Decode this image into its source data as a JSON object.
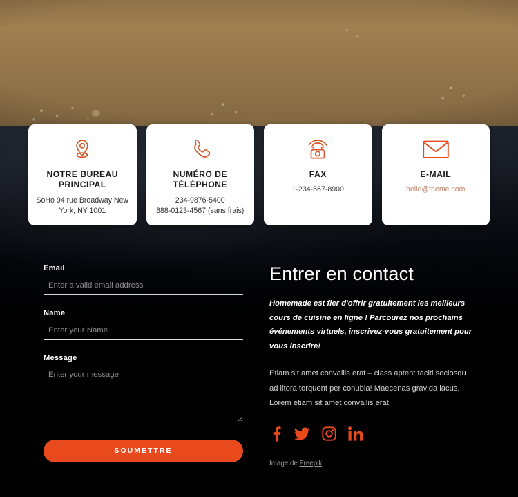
{
  "hero": {
    "alt": "fresh vegetables on dark slate background"
  },
  "cards": [
    {
      "icon": "location-pin-icon",
      "title": "NOTRE BUREAU PRINCIPAL",
      "text": "SoHo 94 rue Broadway New York, NY 1001",
      "is_link": false
    },
    {
      "icon": "phone-handset-icon",
      "title": "NUMÉRO DE TÉLÉPHONE",
      "text": "234-9876-5400\n888-0123-4567 (sans frais)",
      "is_link": false
    },
    {
      "icon": "fax-machine-icon",
      "title": "FAX",
      "text": "1-234-567-8900",
      "is_link": false
    },
    {
      "icon": "envelope-icon",
      "title": "E-MAIL",
      "text": "hello@theme.com",
      "is_link": true
    }
  ],
  "form": {
    "fields": [
      {
        "label": "Email",
        "placeholder": "Enter a valid email address",
        "value": "",
        "type": "email"
      },
      {
        "label": "Name",
        "placeholder": "Enter your Name",
        "value": "",
        "type": "text"
      },
      {
        "label": "Message",
        "placeholder": "Enter your message",
        "value": "",
        "type": "textarea"
      }
    ],
    "submit_label": "SOUMETTRE"
  },
  "info": {
    "heading": "Entrer en contact",
    "lead": "Homemade est fier d'offrir gratuitement les meilleurs cours de cuisine en ligne ! Parcourez nos prochains événements virtuels, inscrivez-vous gratuitement pour vous inscrire!",
    "body": "Etiam sit amet convallis erat – class aptent taciti sociosqu ad litora torquent per conubia! Maecenas gravida lacus. Lorem etiam sit amet convallis erat.",
    "socials": [
      {
        "name": "facebook-icon",
        "label": "Facebook"
      },
      {
        "name": "twitter-icon",
        "label": "Twitter"
      },
      {
        "name": "instagram-icon",
        "label": "Instagram"
      },
      {
        "name": "linkedin-icon",
        "label": "LinkedIn"
      }
    ],
    "credit_prefix": "Image de ",
    "credit_link": "Freepik"
  },
  "colors": {
    "accent": "#e8491d",
    "card_bg": "#ffffff",
    "page_bg": "#000000",
    "email_link": "#c08a70"
  }
}
